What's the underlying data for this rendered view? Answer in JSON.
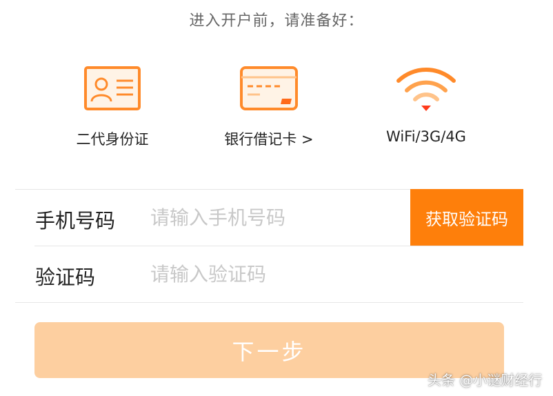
{
  "header": {
    "title": "进入开户前，请准备好："
  },
  "requirements": [
    {
      "label": "二代身份证",
      "icon": "id-card-icon"
    },
    {
      "label": "银行借记卡 >",
      "icon": "bank-card-icon"
    },
    {
      "label": "WiFi/3G/4G",
      "icon": "wifi-icon"
    }
  ],
  "form": {
    "phone": {
      "label": "手机号码",
      "placeholder": "请输入手机号码",
      "value": ""
    },
    "code": {
      "label": "验证码",
      "placeholder": "请输入验证码",
      "value": ""
    },
    "get_code_label": "获取验证码"
  },
  "next_button": {
    "label": "下一步"
  },
  "watermark": {
    "text": "头条 @小谜财经行"
  },
  "colors": {
    "accent": "#fe7f0b",
    "button_disabled": "#fdcfa0",
    "icon": "#ff8a2a"
  }
}
